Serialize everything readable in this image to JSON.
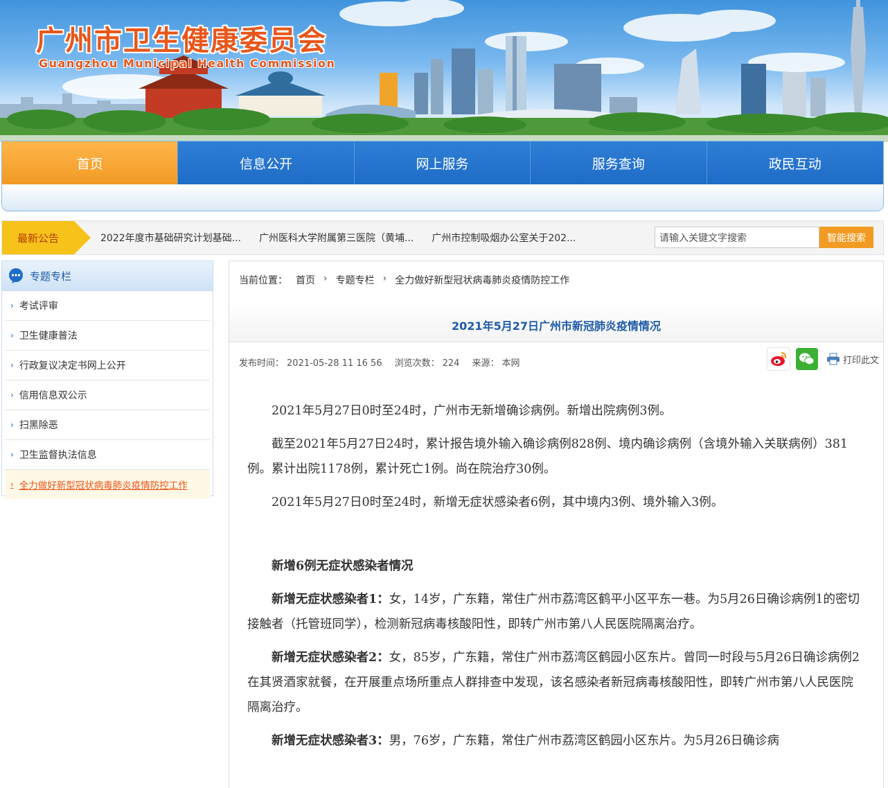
{
  "site": {
    "title": "广州市卫生健康委员会",
    "subtitle": "Guangzhou Municipal Health Commission"
  },
  "nav": {
    "items": [
      "首页",
      "信息公开",
      "网上服务",
      "服务查询",
      "政民互动"
    ]
  },
  "notice": {
    "label": "最新公告",
    "items": [
      "2022年度市基础研究计划基础...",
      "广州医科大学附属第三医院（黄埔...",
      "广州市控制吸烟办公室关于202..."
    ]
  },
  "search": {
    "placeholder": "请输入关键文字搜索",
    "button": "智能搜索"
  },
  "sidebar": {
    "title": "专题专栏",
    "items": [
      "考试评审",
      "卫生健康普法",
      "行政复议决定书网上公开",
      "信用信息双公示",
      "扫黑除恶",
      "卫生监督执法信息",
      "全力做好新型冠状病毒肺炎疫情防控工作"
    ]
  },
  "breadcrumb": {
    "prefix": "当前位置：",
    "items": [
      "首页",
      "专题专栏",
      "全力做好新型冠状病毒肺炎疫情防控工作"
    ]
  },
  "article": {
    "title": "2021年5月27日广州市新冠肺炎疫情情况",
    "meta": {
      "publish_label": "发布时间：",
      "publish_value": "2021-05-28 11 16 56",
      "views_label": "浏览次数：",
      "views_value": "224",
      "source_label": "来源：",
      "source_value": "本网"
    },
    "print_label": "打印此文",
    "paragraphs": [
      "2021年5月27日0时至24时，广州市无新增确诊病例。新增出院病例3例。",
      "截至2021年5月27日24时，累计报告境外输入确诊病例828例、境内确诊病例（含境外输入关联病例）381例。累计出院1178例，累计死亡1例。尚在院治疗30例。",
      "2021年5月27日0时至24时，新增无症状感染者6例，其中境内3例、境外输入3例。"
    ],
    "subheading": "新增6例无症状感染者情况",
    "cases": [
      {
        "label": "新增无症状感染者1：",
        "text": "女，14岁，广东籍，常住广州市荔湾区鹤平小区平东一巷。为5月26日确诊病例1的密切接触者（托管班同学），检测新冠病毒核酸阳性，即转广州市第八人民医院隔离治疗。"
      },
      {
        "label": "新增无症状感染者2：",
        "text": "女，85岁，广东籍，常住广州市荔湾区鹤园小区东片。曾同一时段与5月26日确诊病例2在其贤酒家就餐，在开展重点场所重点人群排查中发现，该名感染者新冠病毒核酸阳性，即转广州市第八人民医院隔离治疗。"
      },
      {
        "label": "新增无症状感染者3：",
        "text": "男，76岁，广东籍，常住广州市荔湾区鹤园小区东片。为5月26日确诊病"
      }
    ]
  },
  "colors": {
    "nav_blue": "#1e6cc6",
    "nav_active": "#f19a24",
    "title_orange": "#e8561a",
    "notice_yellow": "#f7c21a",
    "link_blue": "#1e5aa8"
  }
}
